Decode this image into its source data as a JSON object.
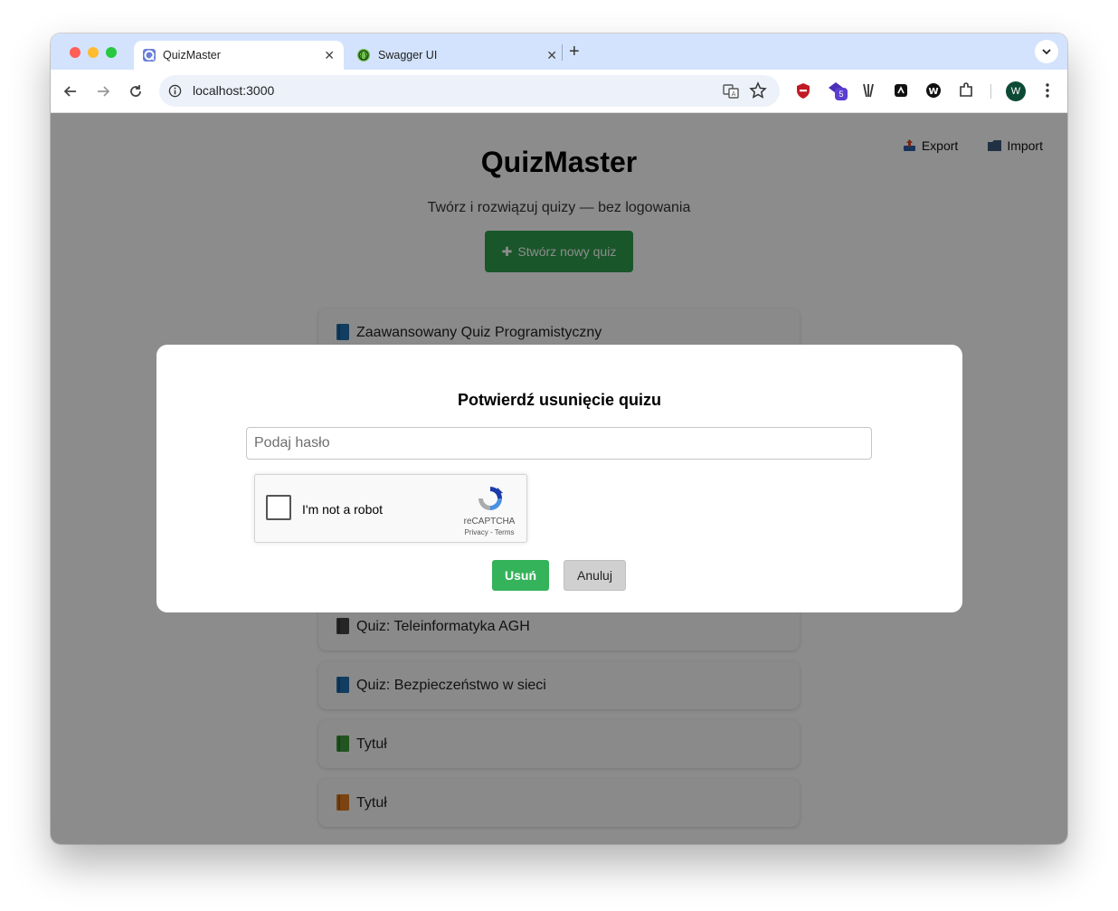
{
  "browser": {
    "tabs": [
      {
        "title": "QuizMaster",
        "close": "✕",
        "active": true,
        "favicon": "quizmaster-favicon-icon"
      },
      {
        "title": "Swagger UI",
        "close": "✕",
        "active": false,
        "favicon": "swagger-favicon-icon"
      }
    ],
    "new_tab": "+",
    "address": "localhost:3000",
    "extension_badge": "5",
    "profile_initial": "W"
  },
  "page": {
    "title": "QuizMaster",
    "subtitle": "Twórz i rozwiązuj quizy — bez logowania",
    "create_button": {
      "icon": "✚",
      "label": "Stwórz nowy quiz"
    },
    "export_label": "Export",
    "import_label": "Import",
    "quizzes": [
      {
        "title": "Zaawansowany Quiz Programistyczny",
        "book_color": "#1f6fb0"
      },
      {
        "title": "Quiz: Teleinformatyka AGH",
        "book_color": "#444444"
      },
      {
        "title": "Quiz: Bezpieczeństwo w sieci",
        "book_color": "#1f6fb0"
      },
      {
        "title": "Tytuł",
        "book_color": "#3d9a3d"
      },
      {
        "title": "Tytuł",
        "book_color": "#e07a1f"
      }
    ]
  },
  "modal": {
    "title": "Potwierdź usunięcie quizu",
    "password_placeholder": "Podaj hasło",
    "recaptcha": {
      "label": "I'm not a robot",
      "brand": "reCAPTCHA",
      "links": "Privacy - Terms"
    },
    "delete_label": "Usuń",
    "cancel_label": "Anuluj"
  },
  "colors": {
    "create_button": "#2e9d4e",
    "delete_button": "#34b35a",
    "cancel_button": "#d0d0d0",
    "tabstrip": "#d3e3fd"
  }
}
